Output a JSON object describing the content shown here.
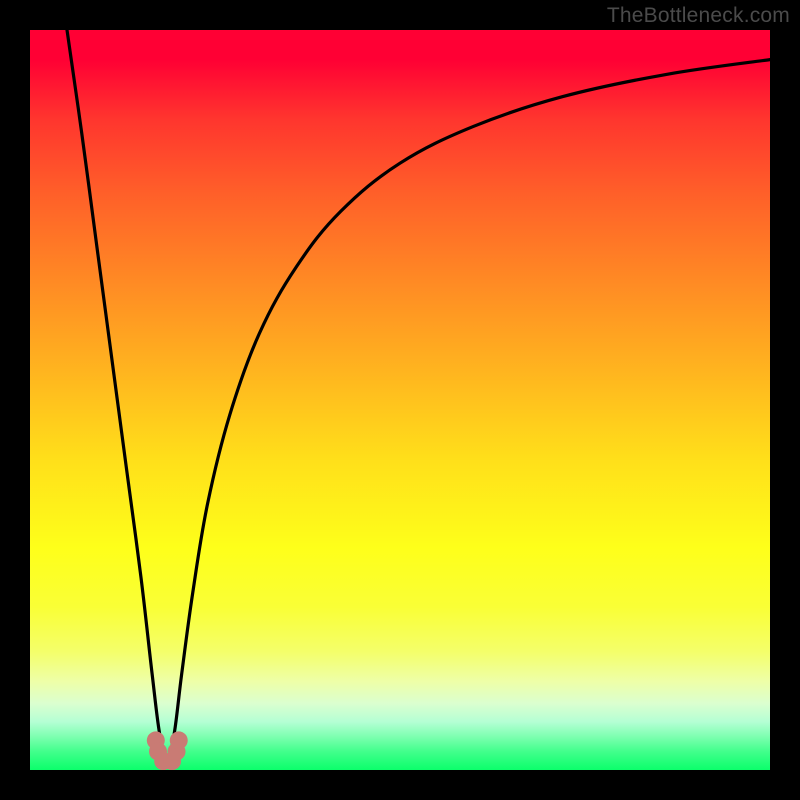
{
  "watermark": "TheBottleneck.com",
  "colors": {
    "frame": "#000000",
    "curve": "#000000",
    "marker_fill": "#c97b74",
    "marker_stroke": "#c97b74"
  },
  "chart_data": {
    "type": "line",
    "title": "",
    "xlabel": "",
    "ylabel": "",
    "x_range": [
      0,
      100
    ],
    "y_range": [
      0,
      100
    ],
    "notch_x": 18.5,
    "curve_points": [
      {
        "x": 5.0,
        "y": 100.0
      },
      {
        "x": 7.0,
        "y": 86.0
      },
      {
        "x": 9.0,
        "y": 71.0
      },
      {
        "x": 11.0,
        "y": 56.0
      },
      {
        "x": 13.0,
        "y": 41.0
      },
      {
        "x": 15.0,
        "y": 26.0
      },
      {
        "x": 16.5,
        "y": 13.0
      },
      {
        "x": 17.5,
        "y": 5.0
      },
      {
        "x": 18.5,
        "y": 1.0
      },
      {
        "x": 19.5,
        "y": 5.0
      },
      {
        "x": 20.5,
        "y": 13.0
      },
      {
        "x": 22.0,
        "y": 24.0
      },
      {
        "x": 24.0,
        "y": 36.0
      },
      {
        "x": 27.0,
        "y": 48.0
      },
      {
        "x": 31.0,
        "y": 59.0
      },
      {
        "x": 36.0,
        "y": 68.0
      },
      {
        "x": 42.0,
        "y": 75.5
      },
      {
        "x": 50.0,
        "y": 82.0
      },
      {
        "x": 60.0,
        "y": 87.0
      },
      {
        "x": 72.0,
        "y": 91.0
      },
      {
        "x": 86.0,
        "y": 94.0
      },
      {
        "x": 100.0,
        "y": 96.0
      }
    ],
    "markers": [
      {
        "x": 17.0,
        "y": 4.0
      },
      {
        "x": 17.3,
        "y": 2.5
      },
      {
        "x": 18.0,
        "y": 1.2
      },
      {
        "x": 19.2,
        "y": 1.2
      },
      {
        "x": 19.8,
        "y": 2.5
      },
      {
        "x": 20.1,
        "y": 4.0
      }
    ]
  }
}
